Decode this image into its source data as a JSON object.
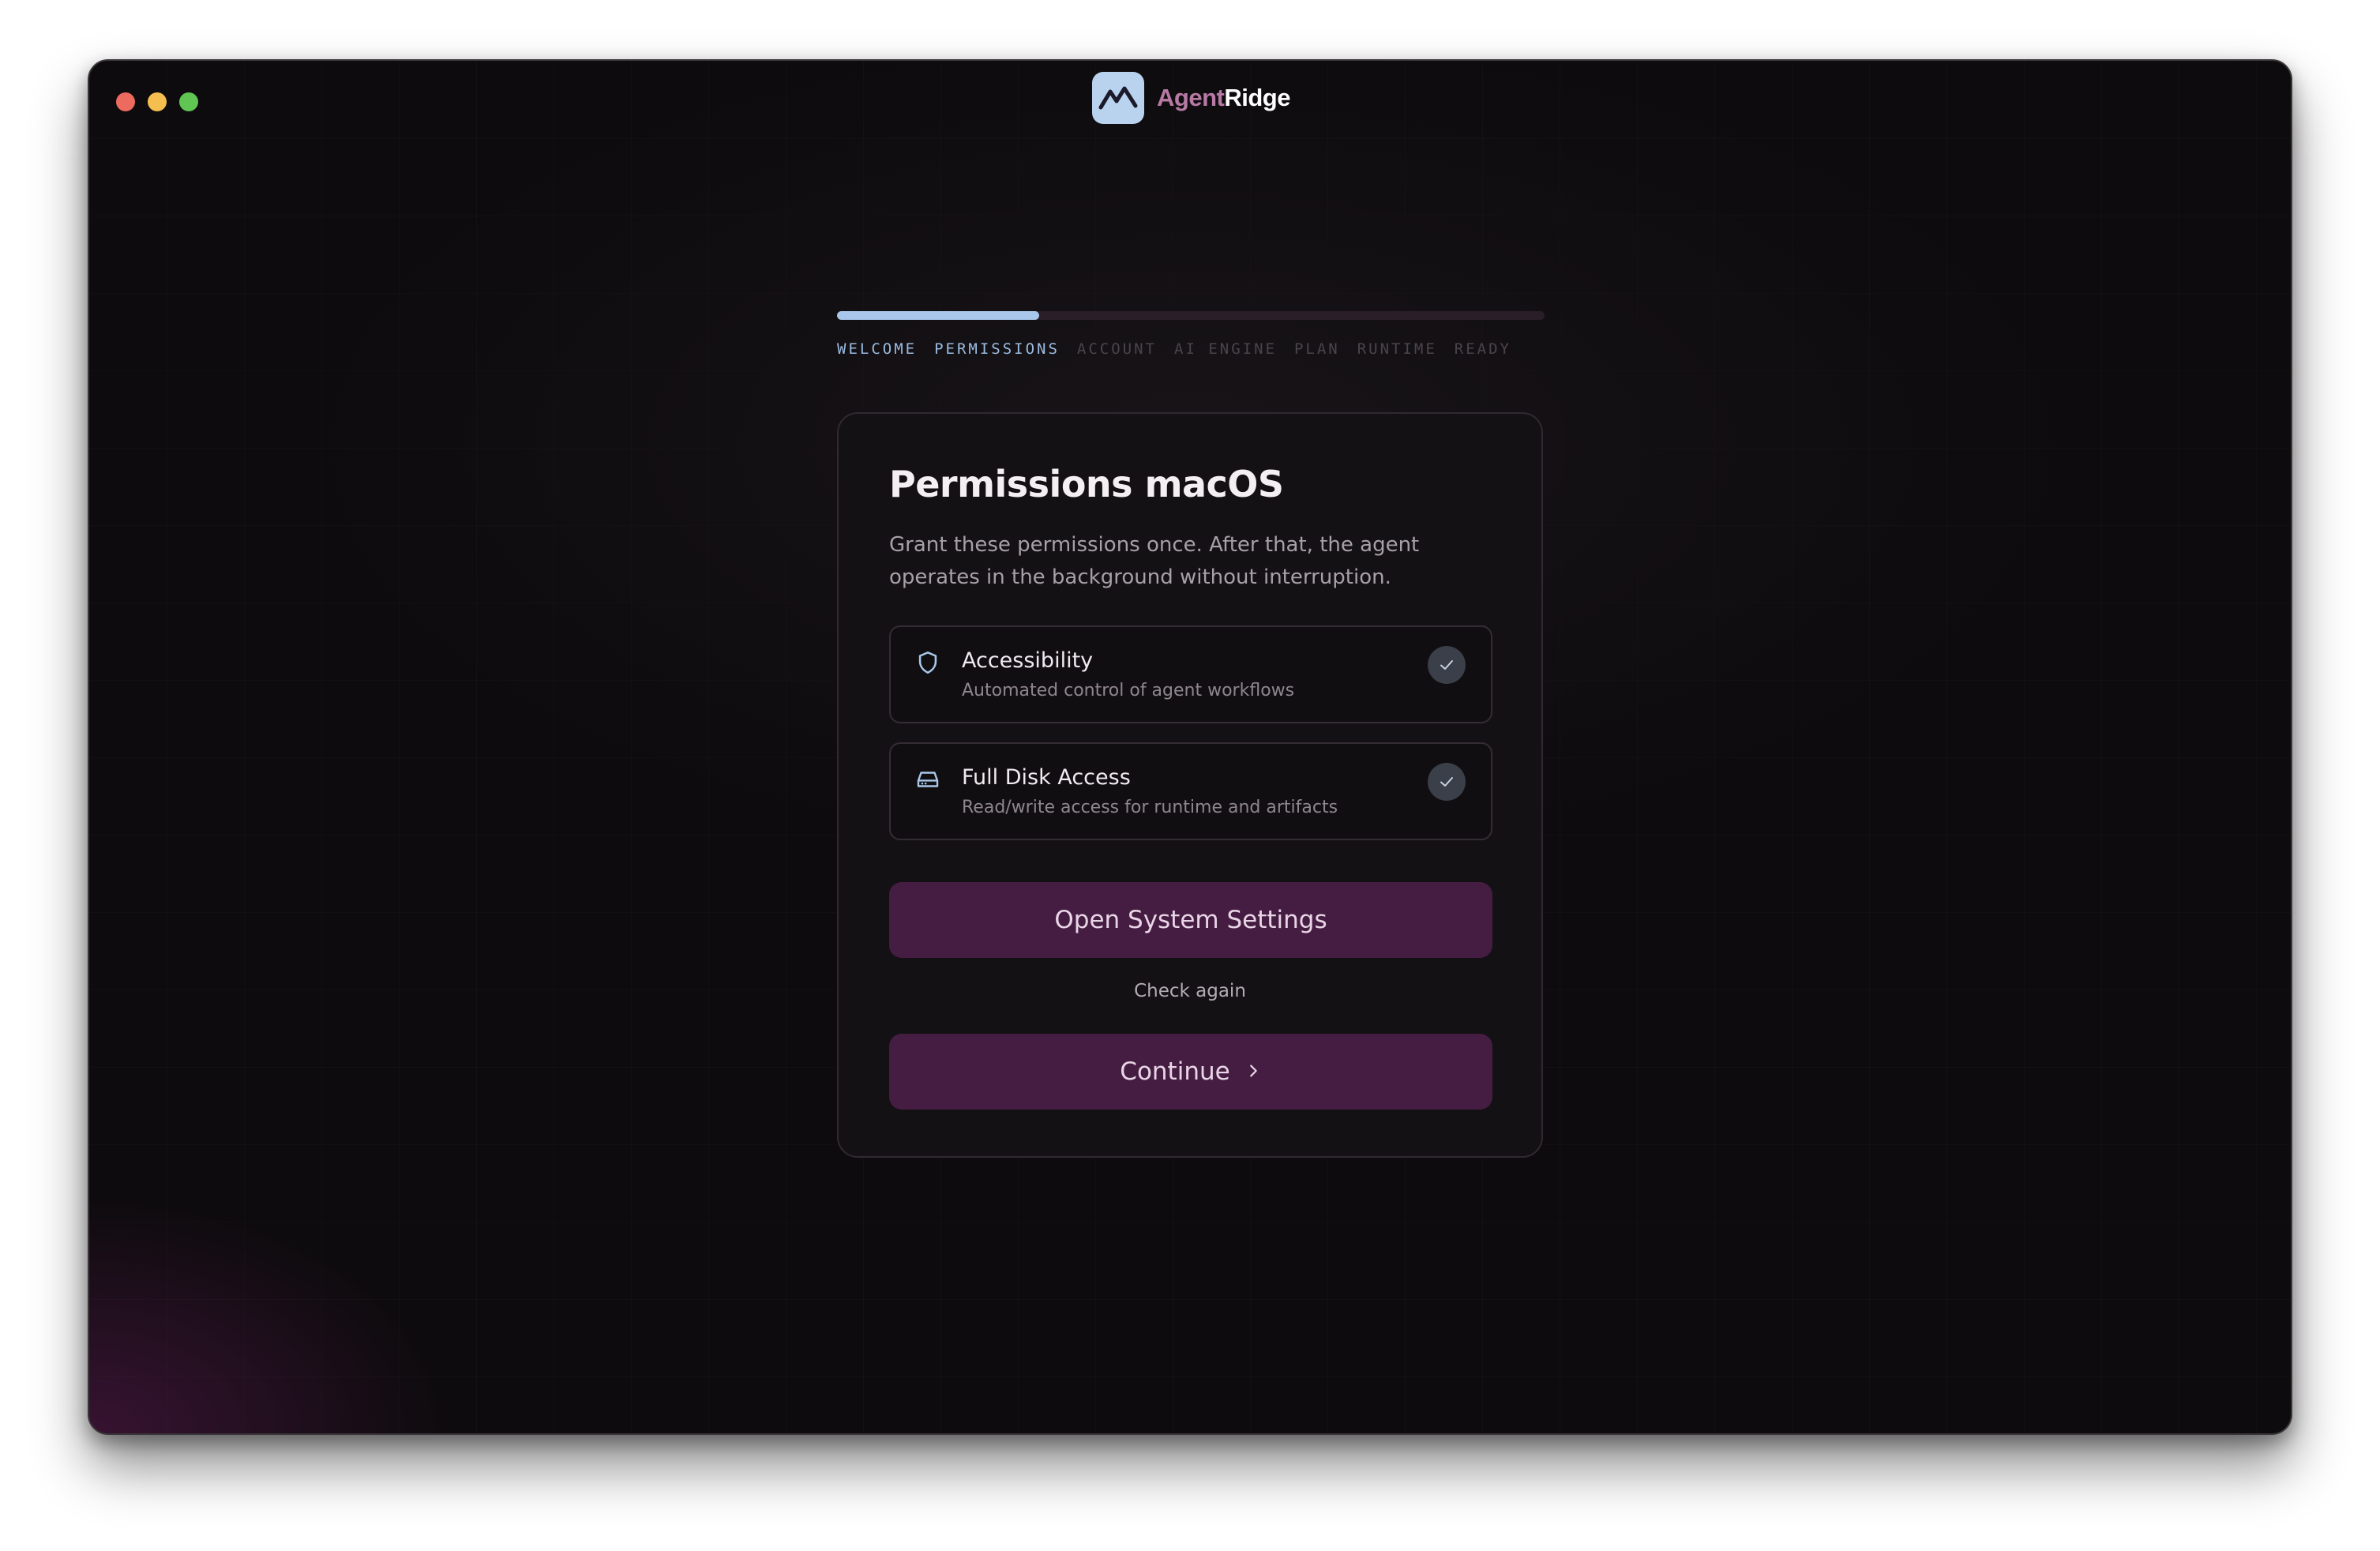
{
  "window": {
    "traffic_lights": [
      "close",
      "minimize",
      "zoom"
    ]
  },
  "brand": {
    "name_part1": "Agent",
    "name_part2": "Ridge",
    "logo_icon": "mountain-icon"
  },
  "progress": {
    "fraction": 0.2857
  },
  "steps": [
    {
      "label": "WELCOME",
      "state": "done"
    },
    {
      "label": "PERMISSIONS",
      "state": "current"
    },
    {
      "label": "ACCOUNT",
      "state": "pending"
    },
    {
      "label": "AI ENGINE",
      "state": "pending"
    },
    {
      "label": "PLAN",
      "state": "pending"
    },
    {
      "label": "RUNTIME",
      "state": "pending"
    },
    {
      "label": "READY",
      "state": "pending"
    }
  ],
  "card": {
    "title": "Permissions macOS",
    "description": "Grant these permissions once. After that, the agent operates in the background without interruption.",
    "permissions": [
      {
        "icon": "shield-icon",
        "title": "Accessibility",
        "subtitle": "Automated control of agent workflows",
        "granted": true
      },
      {
        "icon": "disk-icon",
        "title": "Full Disk Access",
        "subtitle": "Read/write access for runtime and artifacts",
        "granted": true
      }
    ],
    "open_settings_label": "Open System Settings",
    "check_again_label": "Check again",
    "continue_label": "Continue"
  },
  "colors": {
    "accent": "#a9c7ea",
    "button": "#461d42",
    "brand_pink": "#b77aa4"
  }
}
